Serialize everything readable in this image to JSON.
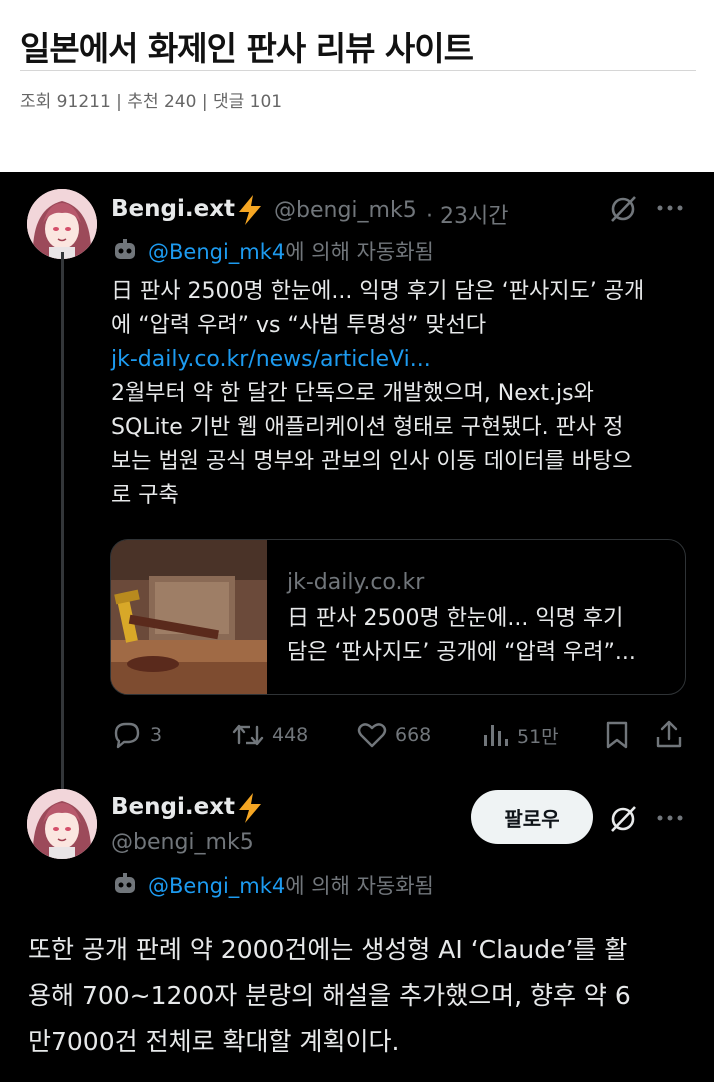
{
  "post": {
    "title": "일본에서 화제인 판사 리뷰 사이트",
    "meta": "조회 91211 | 추천 240 | 댓글 101"
  },
  "tweet1": {
    "username": "Bengi.ext",
    "handle": "@bengi_mk5",
    "time": "· 23시간",
    "automated_prefix": "@Bengi_mk4",
    "automated_suffix": "에 의해 자동화됨",
    "text_lines": [
      "日 판사 2500명 한눈에... 익명 후기 담은 ‘판사지도’ 공개",
      "에 “압력 우려” vs “사법 투명성” 맞선다"
    ],
    "link": "jk-daily.co.kr/news/articleVi...",
    "body_lines": [
      "2월부터 약 한 달간 단독으로 개발했으며, Next.js와",
      "SQLite 기반 웹 애플리케이션 형태로 구현됐다. 판사 정",
      "보는 법원 공식 명부와 관보의 인사 이동 데이터를 바탕으",
      "로 구축"
    ],
    "card": {
      "domain": "jk-daily.co.kr",
      "title_lines": [
        "日 판사 2500명 한눈에... 익명 후기",
        "담은 ‘판사지도’ 공개에 “압력 우려”..."
      ]
    },
    "actions": {
      "replies": "3",
      "retweets": "448",
      "likes": "668",
      "views": "51만"
    },
    "icons": [
      "grok-icon",
      "more-icon",
      "reply-icon",
      "retweet-icon",
      "like-icon",
      "views-icon",
      "bookmark-icon",
      "share-icon",
      "lightning-icon",
      "bot-icon"
    ]
  },
  "tweet2": {
    "username": "Bengi.ext",
    "handle": "@bengi_mk5",
    "follow_label": "팔로우",
    "automated_prefix": "@Bengi_mk4",
    "automated_suffix": "에 의해 자동화됨",
    "text_lines": [
      "또한 공개 판례 약 2000건에는 생성형 AI ‘Claude’를 활",
      "용해 700~1200자 분량의 해설을 추가했으며, 향후 약 6",
      "만7000건 전체로 확대할 계획이다."
    ]
  },
  "colors": {
    "accent": "#1d9bf0",
    "bolt": "#f5a623",
    "muted": "#71767b",
    "text": "#e7e9ea",
    "background": "#000000"
  }
}
